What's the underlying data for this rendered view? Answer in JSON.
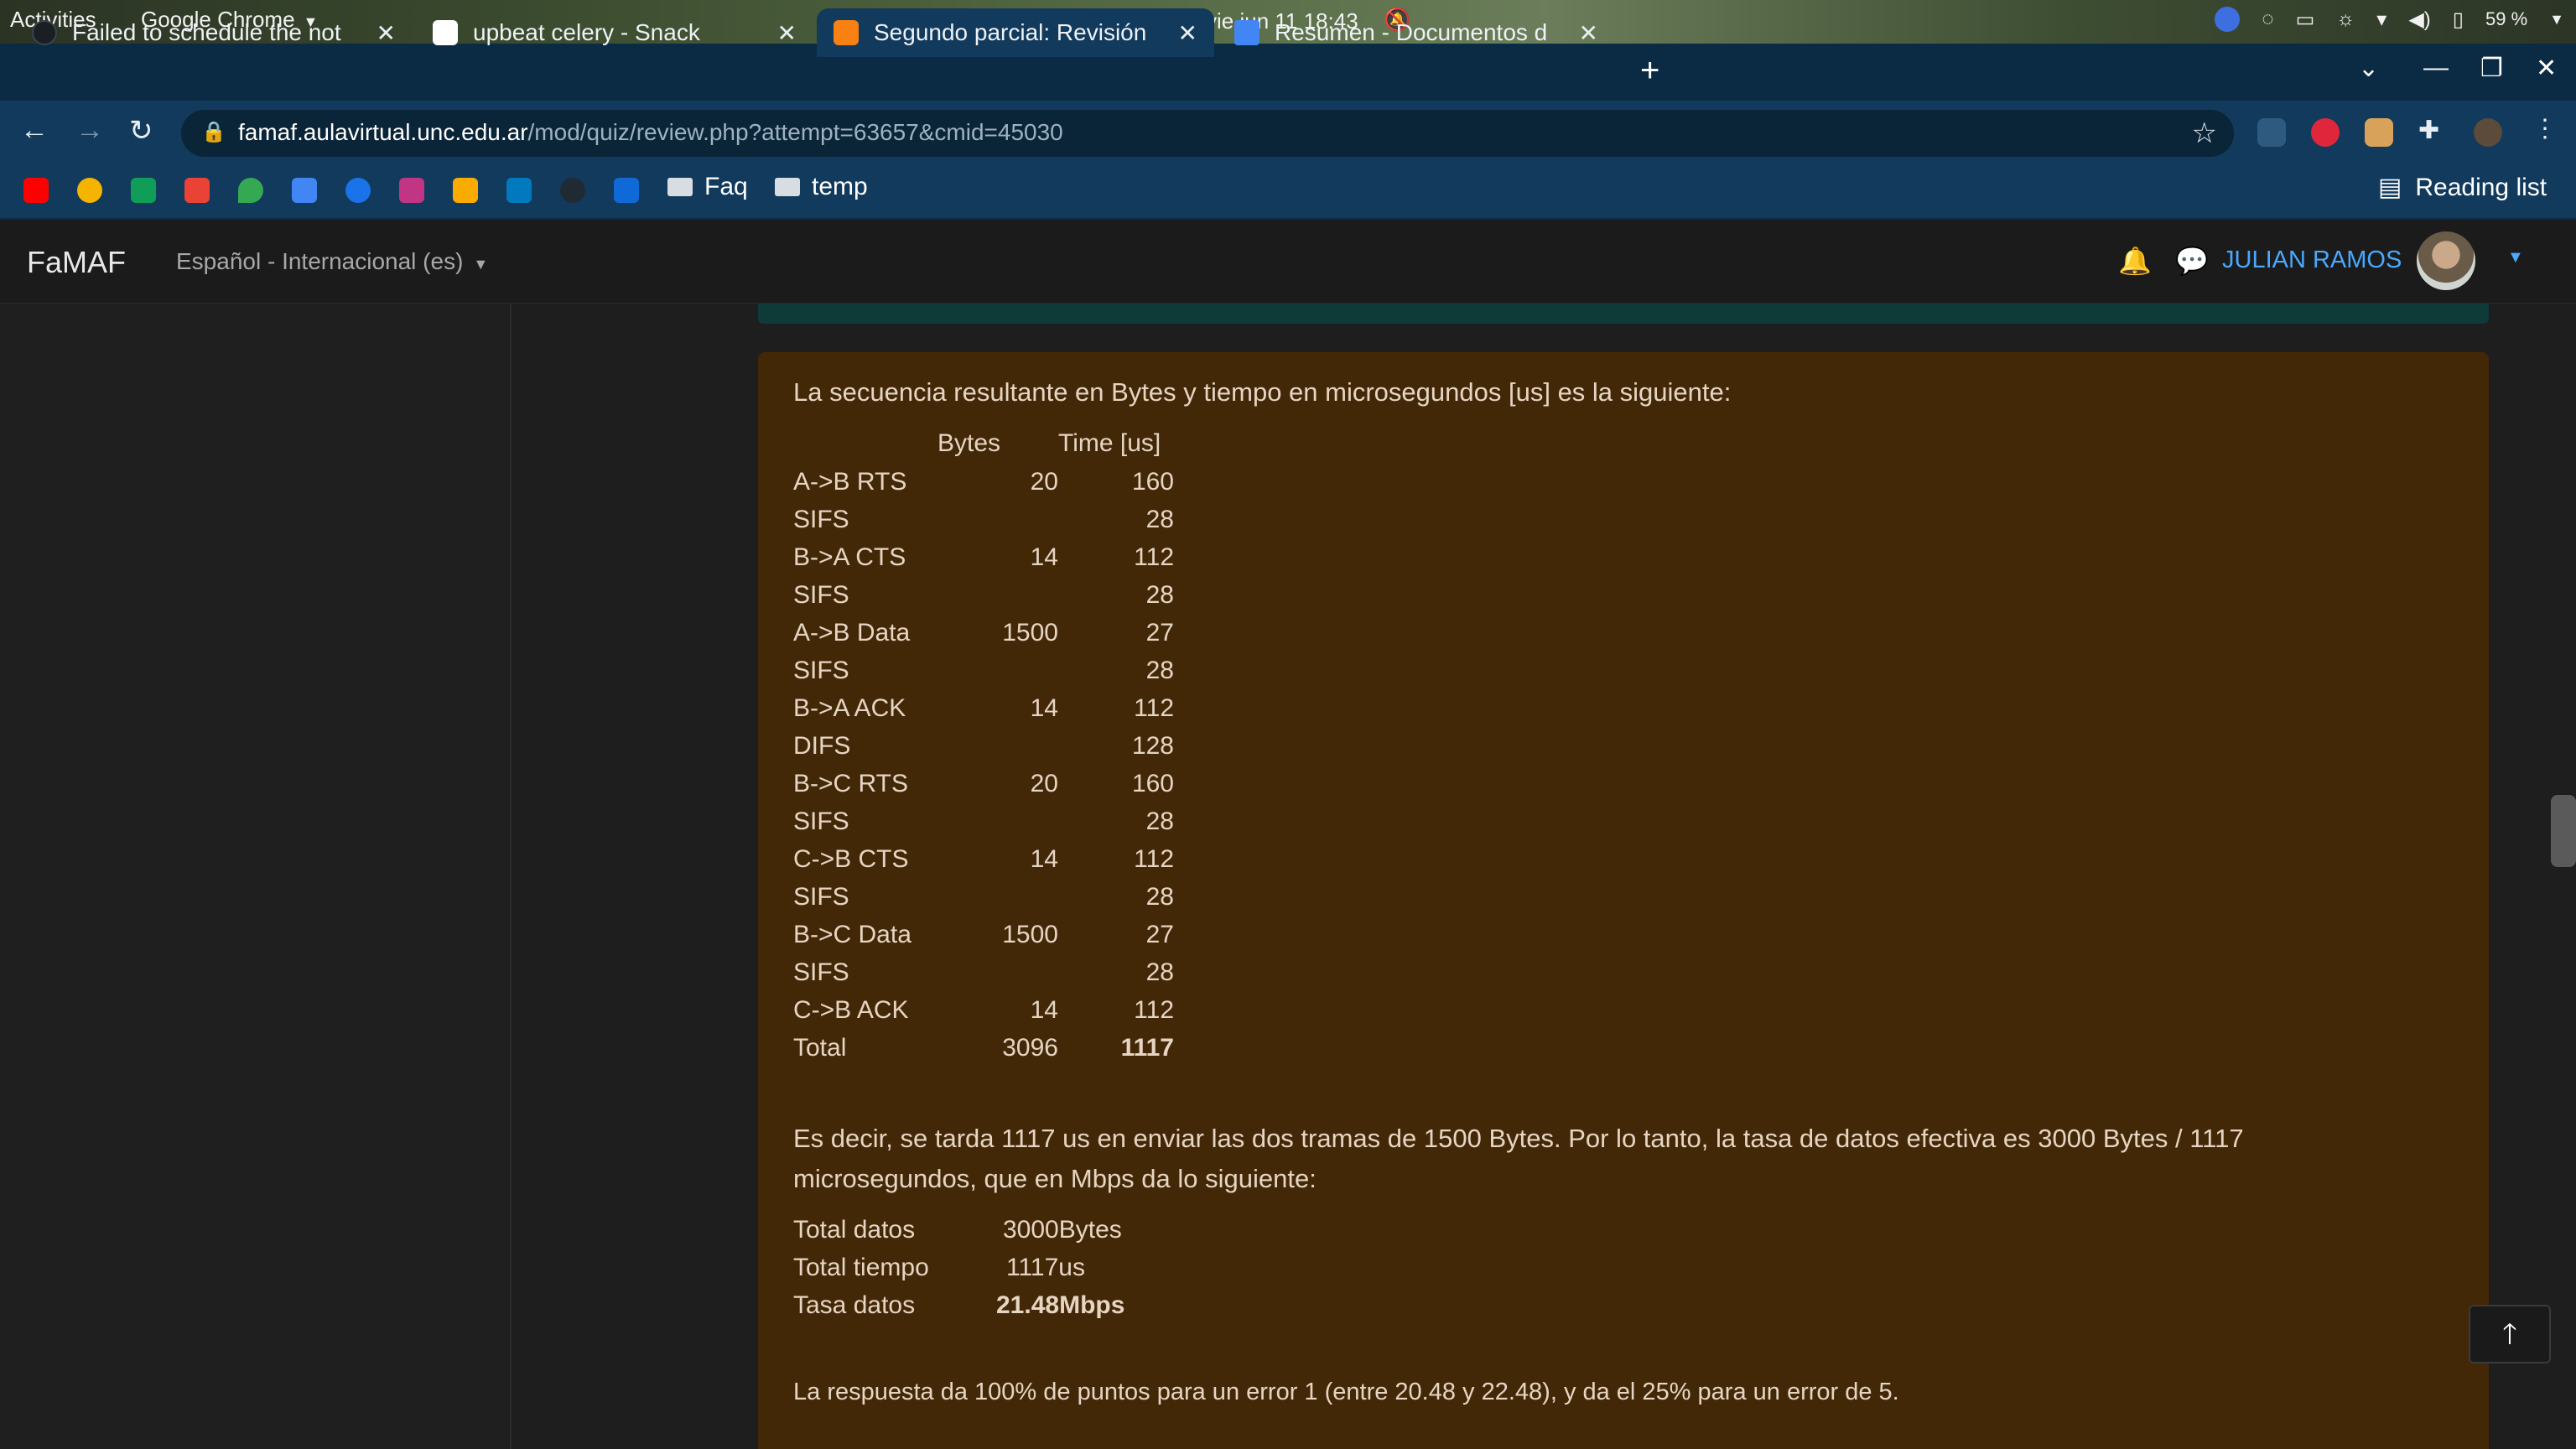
{
  "system_bar": {
    "activities": "Activities",
    "app_name": "Google Chrome",
    "clock": "vie jun 11  18:43",
    "battery": "59 %"
  },
  "tabs": [
    {
      "label": "Failed to schedule the not",
      "icon": "github-icon"
    },
    {
      "label": "upbeat celery - Snack",
      "icon": "snack-icon"
    },
    {
      "label": "Segundo parcial: Revisión",
      "icon": "moodle-icon"
    },
    {
      "label": "Resumen - Documentos d",
      "icon": "google-docs-icon"
    }
  ],
  "address_bar": {
    "host": "famaf.aulavirtual.unc.edu.ar",
    "path": "/mod/quiz/review.php?attempt=63657&cmid=45030"
  },
  "bookmarks": {
    "folders": [
      "Faq",
      "temp"
    ],
    "reading_list": "Reading list"
  },
  "moodle_nav": {
    "brand": "FaMAF",
    "language": "Español - Internacional (es)",
    "user": "JULIAN RAMOS"
  },
  "feedback": {
    "intro": "La secuencia resultante en Bytes y tiempo en microsegundos [us] es la siguiente:",
    "table_headers": {
      "bytes": "Bytes",
      "time": "Time [us]"
    },
    "rows": [
      {
        "label": "A->B RTS",
        "bytes": "20",
        "time": "160"
      },
      {
        "label": "SIFS",
        "bytes": "",
        "time": "28"
      },
      {
        "label": "B->A CTS",
        "bytes": "14",
        "time": "112"
      },
      {
        "label": "SIFS",
        "bytes": "",
        "time": "28"
      },
      {
        "label": "A->B Data",
        "bytes": "1500",
        "time": "27"
      },
      {
        "label": "SIFS",
        "bytes": "",
        "time": "28"
      },
      {
        "label": "B->A ACK",
        "bytes": "14",
        "time": "112"
      },
      {
        "label": "DIFS",
        "bytes": "",
        "time": "128"
      },
      {
        "label": "B->C RTS",
        "bytes": "20",
        "time": "160"
      },
      {
        "label": "SIFS",
        "bytes": "",
        "time": "28"
      },
      {
        "label": "C->B CTS",
        "bytes": "14",
        "time": "112"
      },
      {
        "label": "SIFS",
        "bytes": "",
        "time": "28"
      },
      {
        "label": "B->C Data",
        "bytes": "1500",
        "time": "27"
      },
      {
        "label": "SIFS",
        "bytes": "",
        "time": "28"
      },
      {
        "label": "C->B ACK",
        "bytes": "14",
        "time": "112"
      },
      {
        "label": "Total",
        "bytes": "3096",
        "time": "1117"
      }
    ],
    "explanation_line1": "Es decir, se tarda 1117 us en enviar las dos tramas de 1500 Bytes. Por lo tanto, la tasa de datos efectiva es 3000 Bytes / 1117",
    "explanation_line2": "microsegundos, que en Mbps da lo siguiente:",
    "summary": [
      {
        "label": "Total datos",
        "value": "3000Bytes"
      },
      {
        "label": "Total tiempo",
        "value": "1117us"
      },
      {
        "label": "Tasa datos",
        "value": "21.48Mbps"
      }
    ],
    "grading_note": "La respuesta da 100% de puntos para un error 1 (entre 20.48 y 22.48), y da el 25% para un error de 5."
  }
}
